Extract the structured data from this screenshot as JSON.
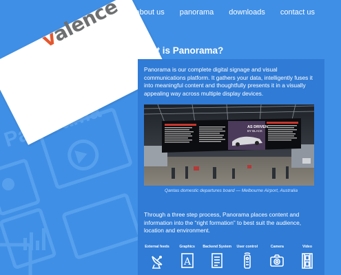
{
  "brand": {
    "logo_text": "valence",
    "logo_first": "v",
    "logo_rest": "alence"
  },
  "nav": {
    "items": [
      "about us",
      "panorama",
      "downloads",
      "contact us"
    ]
  },
  "page": {
    "heading": "What is Panorama?"
  },
  "content": {
    "intro": "Panorama is our complete digital signage and visual communications platform. It gathers your data, intelligently fuses it into meaningful content and thoughtfully presents it in a visually appealing way across multiple display devices.",
    "caption": "Qantas domestic departures board — Melbourne Airport, Australia",
    "body": "Through a three step process, Panorama places content and information into the “right formation” to best suit the audience, location and environment."
  },
  "photo_overlay": {
    "ad_line1": "AS DRIVEN",
    "ad_line2": "BY BLACK"
  },
  "background": {
    "watermark": "Panorama"
  },
  "sources": [
    {
      "label": "External feeds",
      "icon": "satellite-dish-icon"
    },
    {
      "label": "Graphics",
      "icon": "letter-a-icon"
    },
    {
      "label": "Backend System",
      "icon": "document-icon"
    },
    {
      "label": "User control",
      "icon": "remote-control-icon"
    },
    {
      "label": "Camera",
      "icon": "camera-icon"
    },
    {
      "label": "Video",
      "icon": "film-strip-icon"
    }
  ],
  "colors": {
    "background": "#3f8fe6",
    "panel": "#2f7bd6",
    "logo_grey": "#6d6f71",
    "logo_accent": "#e4572e"
  }
}
